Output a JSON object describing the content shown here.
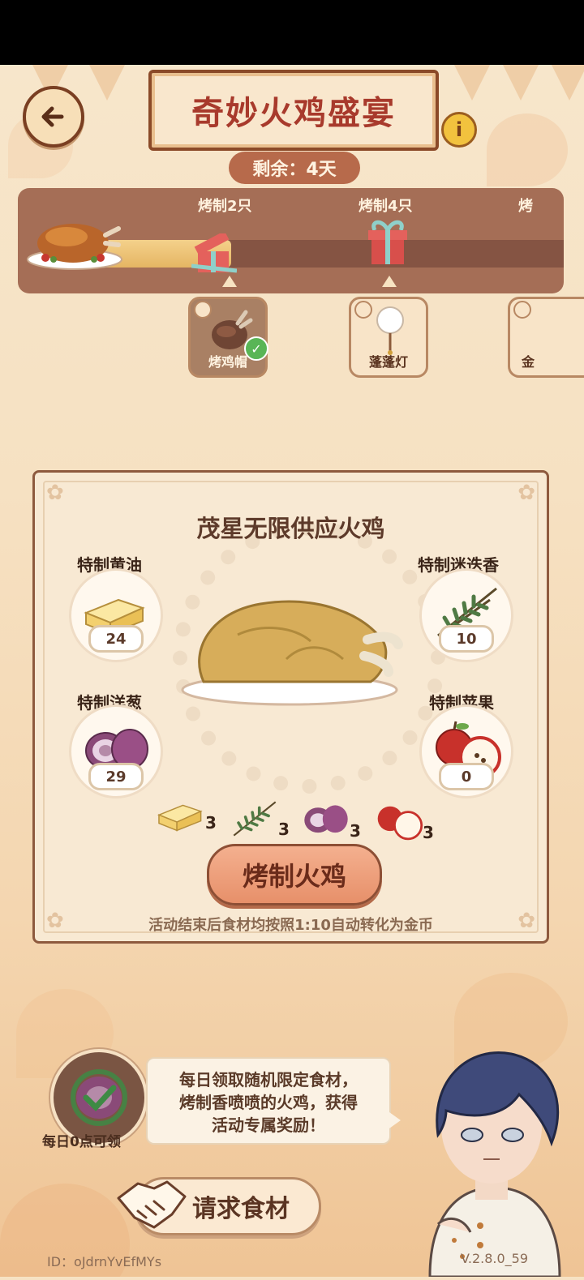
{
  "header": {
    "title": "奇妙火鸡盛宴",
    "remaining": "剩余：4天"
  },
  "progress": {
    "fill_fraction": 0.6,
    "milestones": [
      {
        "label": "烤制2只",
        "reward": "烤鸡帽",
        "claimed": true
      },
      {
        "label": "烤制4只",
        "reward": "蓬蓬灯",
        "claimed": false
      },
      {
        "label": "烤",
        "reward": "金",
        "claimed": false
      }
    ]
  },
  "main": {
    "title": "茂星无限供应火鸡",
    "ingredients": [
      {
        "name": "特制黄油",
        "count": "24",
        "icon": "butter-icon"
      },
      {
        "name": "特制迷迭香",
        "count": "10",
        "icon": "rosemary-icon"
      },
      {
        "name": "特制洋葱",
        "count": "29",
        "icon": "onion-icon"
      },
      {
        "name": "特制苹果",
        "count": "0",
        "icon": "apple-icon"
      }
    ],
    "costs": [
      "3",
      "3",
      "3",
      "3"
    ],
    "roast_button": "烤制火鸡",
    "note": "活动结束后食材均按照1:10自动转化为金币"
  },
  "daily": {
    "label": "每日0点可领",
    "bubble_lines": [
      "每日领取随机限定食材，",
      "烤制香喷喷的火鸡，获得",
      "活动专属奖励！"
    ]
  },
  "request_button": "请求食材",
  "footer": {
    "id": "ID：oJdrnYvEfMYs",
    "version": "V.2.8.0_59"
  },
  "colors": {
    "accent": "#a83a2c",
    "panel_border": "#8e5a3e",
    "progress_bg": "#a56e56"
  }
}
